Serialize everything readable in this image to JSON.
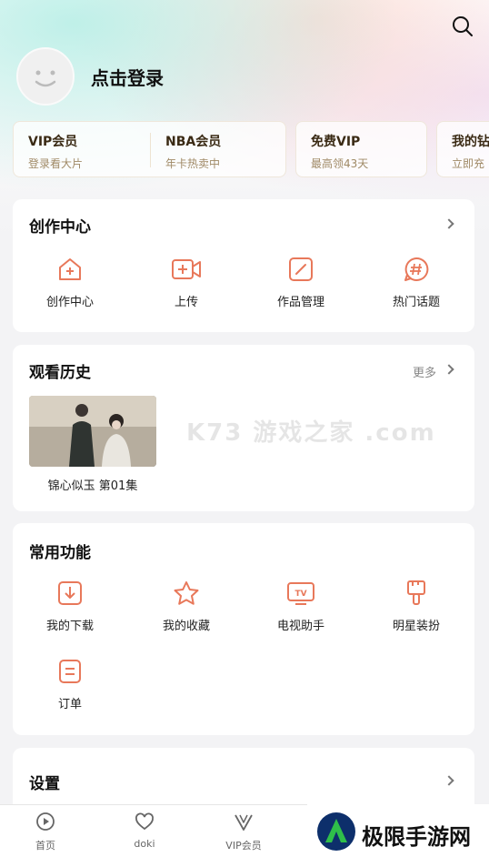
{
  "profile": {
    "login_label": "点击登录"
  },
  "vip_cards": [
    {
      "title": "VIP会员",
      "subtitle": "登录看大片"
    },
    {
      "title": "NBA会员",
      "subtitle": "年卡热卖中"
    },
    {
      "title": "免费VIP",
      "subtitle": "最高领43天"
    },
    {
      "title": "我的钻",
      "subtitle": "立即充"
    }
  ],
  "creation": {
    "title": "创作中心",
    "items": [
      {
        "label": "创作中心",
        "icon": "home-plus-icon"
      },
      {
        "label": "上传",
        "icon": "video-plus-icon"
      },
      {
        "label": "作品管理",
        "icon": "edit-icon"
      },
      {
        "label": "热门话题",
        "icon": "hashtag-icon"
      }
    ]
  },
  "history": {
    "title": "观看历史",
    "more_label": "更多",
    "items": [
      {
        "label": "锦心似玉 第01集"
      }
    ]
  },
  "functions": {
    "title": "常用功能",
    "items": [
      {
        "label": "我的下载",
        "icon": "download-icon"
      },
      {
        "label": "我的收藏",
        "icon": "star-icon"
      },
      {
        "label": "电视助手",
        "icon": "tv-icon"
      },
      {
        "label": "明星装扮",
        "icon": "brush-icon"
      },
      {
        "label": "订单",
        "icon": "order-icon"
      }
    ]
  },
  "settings": {
    "title": "设置"
  },
  "watermark": {
    "text": "K73 游戏之家 .com"
  },
  "tabbar": [
    {
      "label": "首页",
      "icon": "play-icon"
    },
    {
      "label": "doki",
      "icon": "heart-bubble-icon"
    },
    {
      "label": "VIP会员",
      "icon": "vip-icon"
    }
  ],
  "brand": {
    "text": "极限手游网"
  },
  "colors": {
    "accent": "#e8785a",
    "gold": "#a08a66"
  }
}
